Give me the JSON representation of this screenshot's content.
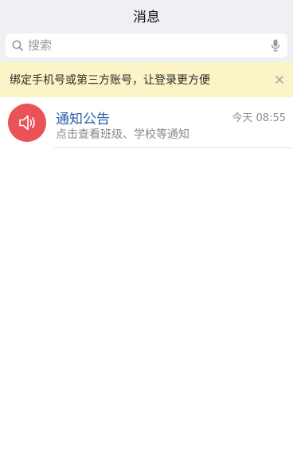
{
  "nav": {
    "title": "消息"
  },
  "search": {
    "placeholder": "搜索",
    "value": ""
  },
  "banner": {
    "text": "绑定手机号或第三方账号，让登录更方便"
  },
  "messages": [
    {
      "icon": "speaker-icon",
      "title": "通知公告",
      "time": "今天 08:55",
      "subtitle": "点击查看班级、学校等通知"
    }
  ],
  "colors": {
    "nav_bg": "#efeff4",
    "banner_bg": "#fbf4c6",
    "avatar_bg": "#e95257",
    "title_color": "#2a5ca8"
  }
}
